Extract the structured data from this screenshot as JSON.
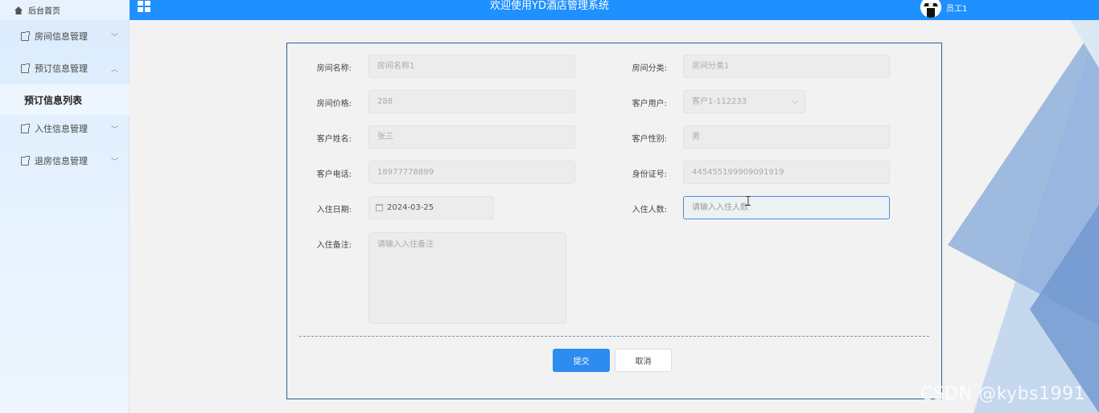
{
  "topbar": {
    "home_label": "后台首页",
    "app_title": "欢迎使用YD酒店管理系统",
    "user_name": "员工1"
  },
  "sidebar": {
    "items": [
      {
        "label": "房间信息管理",
        "chevron": "﹀"
      },
      {
        "label": "预订信息管理",
        "chevron": "︿"
      },
      {
        "label": "入住信息管理",
        "chevron": "﹀"
      },
      {
        "label": "退房信息管理",
        "chevron": "﹀"
      }
    ],
    "active_sub": "预订信息列表"
  },
  "form": {
    "room_name": {
      "label": "房间名称:",
      "value": "房间名称1"
    },
    "room_category": {
      "label": "房间分类:",
      "value": "房间分类1"
    },
    "room_price": {
      "label": "房间价格:",
      "value": "288"
    },
    "customer_user": {
      "label": "客户用户:",
      "value": "客户1-112233"
    },
    "customer_name": {
      "label": "客户姓名:",
      "value": "张三"
    },
    "customer_gender": {
      "label": "客户性别:",
      "value": "男"
    },
    "customer_phone": {
      "label": "客户电话:",
      "value": "18977778899"
    },
    "id_number": {
      "label": "身份证号:",
      "value": "445455199909091919"
    },
    "checkin_date": {
      "label": "入住日期:",
      "value": "2024-03-25"
    },
    "guest_count": {
      "label": "入住人数:",
      "placeholder": "请输入入住人数"
    },
    "checkin_note": {
      "label": "入住备注:",
      "placeholder": "请输入入住备注"
    },
    "submit_label": "提交",
    "cancel_label": "取消"
  },
  "watermark": "CSDN @kybs1991",
  "colors": {
    "accent": "#1e90ff",
    "primary_button": "#2d8cf0",
    "card_border": "#2a5c9a"
  }
}
